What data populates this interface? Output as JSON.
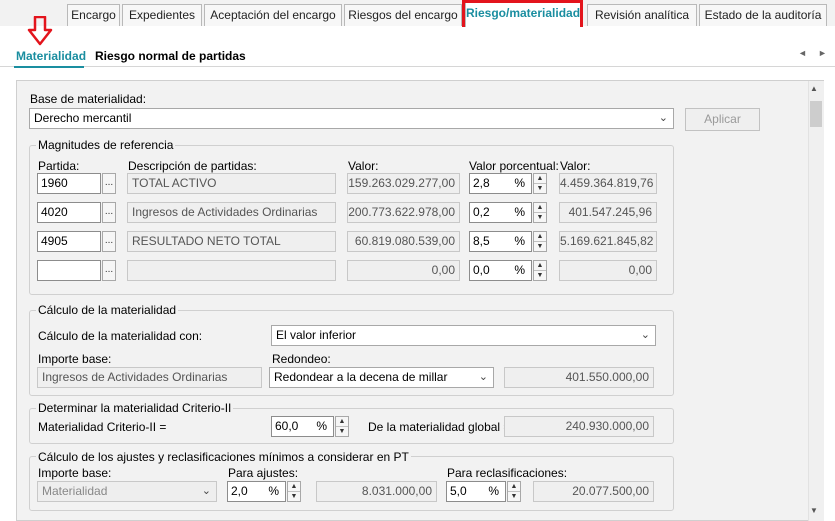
{
  "top_tabs": [
    "Encargo",
    "Expedientes",
    "Aceptación del encargo",
    "Riesgos del encargo",
    "Riesgo/materialidad",
    "Revisión analítica",
    "Estado de la auditoría"
  ],
  "sub_tabs": [
    "Materialidad",
    "Riesgo normal de partidas"
  ],
  "icons": {
    "nav_prev": "◄",
    "nav_next": "►",
    "chevron": "⌄",
    "dots": "...",
    "spin_up": "▲",
    "spin_down": "▼",
    "scroll_up": "▲",
    "scroll_down": "▼"
  },
  "base": {
    "label": "Base de materialidad:",
    "value": "Derecho mercantil",
    "apply_button": "Aplicar"
  },
  "magnitudes": {
    "title": "Magnitudes de referencia",
    "headers": {
      "partida": "Partida:",
      "descripcion": "Descripción de partidas:",
      "valor": "Valor:",
      "porcentual": "Valor porcentual:",
      "valor2": "Valor:"
    },
    "rows": [
      {
        "partida": "1960",
        "descripcion": "TOTAL ACTIVO",
        "valor": "159.263.029.277,00",
        "pct": "2,8",
        "resultado": "4.459.364.819,76"
      },
      {
        "partida": "4020",
        "descripcion": "Ingresos de Actividades Ordinarias",
        "valor": "200.773.622.978,00",
        "pct": "0,2",
        "resultado": "401.547.245,96"
      },
      {
        "partida": "4905",
        "descripcion": "RESULTADO NETO TOTAL",
        "valor": "60.819.080.539,00",
        "pct": "8,5",
        "resultado": "5.169.621.845,82"
      },
      {
        "partida": "",
        "descripcion": "",
        "valor": "0,00",
        "pct": "0,0",
        "resultado": "0,00"
      }
    ],
    "pct_symbol": "%"
  },
  "calculo": {
    "title": "Cálculo de la materialidad",
    "con_label": "Cálculo de la materialidad con:",
    "con_value": "El valor inferior",
    "importe_label": "Importe base:",
    "importe_value": "Ingresos de Actividades Ordinarias",
    "redondeo_label": "Redondeo:",
    "redondeo_value": "Redondear a la decena de millar",
    "redondeo_result": "401.550.000,00"
  },
  "criterio": {
    "title": "Determinar la materialidad Criterio-II",
    "label": "Materialidad Criterio-II =",
    "pct": "60,0",
    "global_label": "De la materialidad global =",
    "global_value": "240.930.000,00"
  },
  "ajustes": {
    "title": "Cálculo de los ajustes y reclasificaciones mínimos a considerar en PT",
    "importe_label": "Importe base:",
    "importe_value": "Materialidad",
    "ajustes_label": "Para ajustes:",
    "ajustes_pct": "2,0",
    "ajustes_value": "8.031.000,00",
    "reclas_label": "Para reclasificaciones:",
    "reclas_pct": "5,0",
    "reclas_value": "20.077.500,00"
  }
}
